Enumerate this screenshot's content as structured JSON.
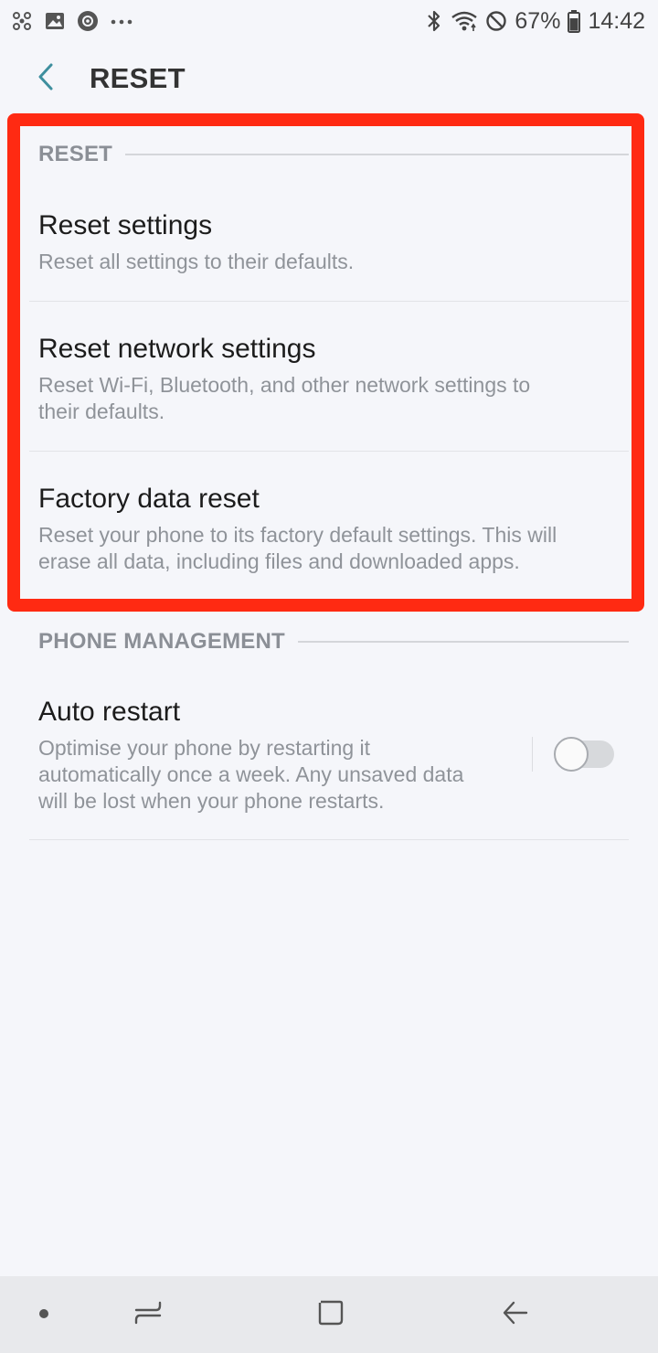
{
  "status_bar": {
    "left_icons": [
      "fan-icon",
      "image-icon",
      "settings-circle-icon",
      "more-dots-icon"
    ],
    "right_icons": [
      "bluetooth-icon",
      "wifi-icon",
      "do-not-disturb-icon",
      "battery-icon"
    ],
    "battery": "67%",
    "time": "14:42"
  },
  "header": {
    "back_icon": "chevron-left-icon",
    "title": "RESET"
  },
  "sections": {
    "reset": {
      "header": "RESET",
      "items": [
        {
          "title": "Reset settings",
          "description": "Reset all settings to their defaults."
        },
        {
          "title": "Reset network settings",
          "description": "Reset Wi-Fi, Bluetooth, and other network settings to their defaults."
        },
        {
          "title": "Factory data reset",
          "description": "Reset your phone to its factory default settings. This will erase all data, including files and downloaded apps."
        }
      ]
    },
    "phone_management": {
      "header": "PHONE MANAGEMENT",
      "items": [
        {
          "title": "Auto restart",
          "description": "Optimise your phone by restarting it automatically once a week. Any unsaved data will be lost when your phone restarts.",
          "toggle_on": false
        }
      ]
    }
  },
  "highlight_color": "#ff2a12",
  "nav_bar": {
    "items": [
      "dot-icon",
      "recent-apps-icon",
      "home-icon",
      "back-arrow-icon"
    ]
  }
}
